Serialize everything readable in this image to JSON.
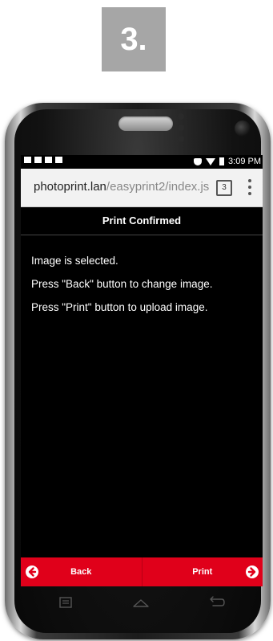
{
  "step": {
    "label": "3."
  },
  "status_bar": {
    "time": "3:09 PM"
  },
  "browser": {
    "url_host": "photoprint.lan",
    "url_path": "/easyprint2/index.js",
    "tab_count": "3"
  },
  "page": {
    "title": "Print Confirmed",
    "messages": [
      "Image is selected.",
      "Press \"Back\" button to change image.",
      "Press \"Print\" button to upload image."
    ]
  },
  "footer": {
    "back_label": "Back",
    "print_label": "Print"
  },
  "colors": {
    "accent_red": "#e0001a",
    "badge_gray": "#a6a6a6",
    "screen_bg": "#000000"
  },
  "icons": {
    "back": "arrow-left-circle-icon",
    "print": "arrow-right-circle-icon",
    "menu": "kebab-menu-icon",
    "tabs": "tab-count-icon"
  }
}
